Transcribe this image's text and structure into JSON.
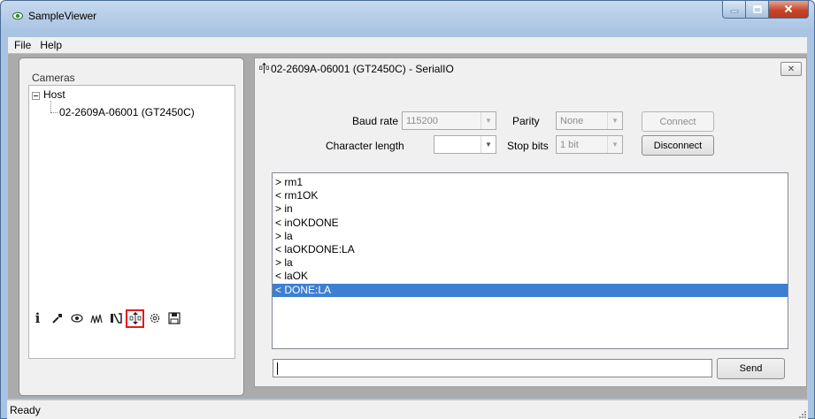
{
  "window": {
    "title": "SampleViewer",
    "minimize_icon": "minimize-icon",
    "maximize_icon": "maximize-icon",
    "close_icon": "close-icon"
  },
  "menu": [
    {
      "label": "File"
    },
    {
      "label": "Help"
    }
  ],
  "cameras": {
    "header": "Cameras",
    "tree": {
      "host": "Host",
      "camera": "02-2609A-06001 (GT2450C)"
    },
    "toolbar": [
      {
        "icon": "info-icon",
        "glyph": "i"
      },
      {
        "icon": "wrench-icon",
        "glyph": "⚒"
      },
      {
        "icon": "eye-icon",
        "glyph": "◉"
      },
      {
        "icon": "histogram-icon",
        "glyph": "⋀⋀"
      },
      {
        "icon": "io-icon",
        "glyph": "⋈"
      },
      {
        "icon": "serial-io-icon",
        "glyph": "⇅",
        "active": true
      },
      {
        "icon": "settings-icon",
        "glyph": "⚙"
      },
      {
        "icon": "save-icon",
        "glyph": "▣"
      }
    ]
  },
  "serial": {
    "title": "02-2609A-06001 (GT2450C) - SerialIO",
    "close_label": "✕",
    "baud_rate_label": "Baud rate",
    "baud_rate_value": "115200",
    "parity_label": "Parity",
    "parity_value": "None",
    "char_length_label": "Character length",
    "char_length_value": "",
    "stop_bits_label": "Stop bits",
    "stop_bits_value": "1 bit",
    "connect_label": "Connect",
    "disconnect_label": "Disconnect",
    "log": [
      "> rm1",
      "< rm1OK",
      "> in",
      "< inOKDONE",
      "> la",
      "< laOKDONE:LA",
      "> la",
      "< laOK",
      "< DONE:LA"
    ],
    "selected_index": 8,
    "send_value": "",
    "send_label": "Send"
  },
  "status": {
    "text": "Ready"
  }
}
